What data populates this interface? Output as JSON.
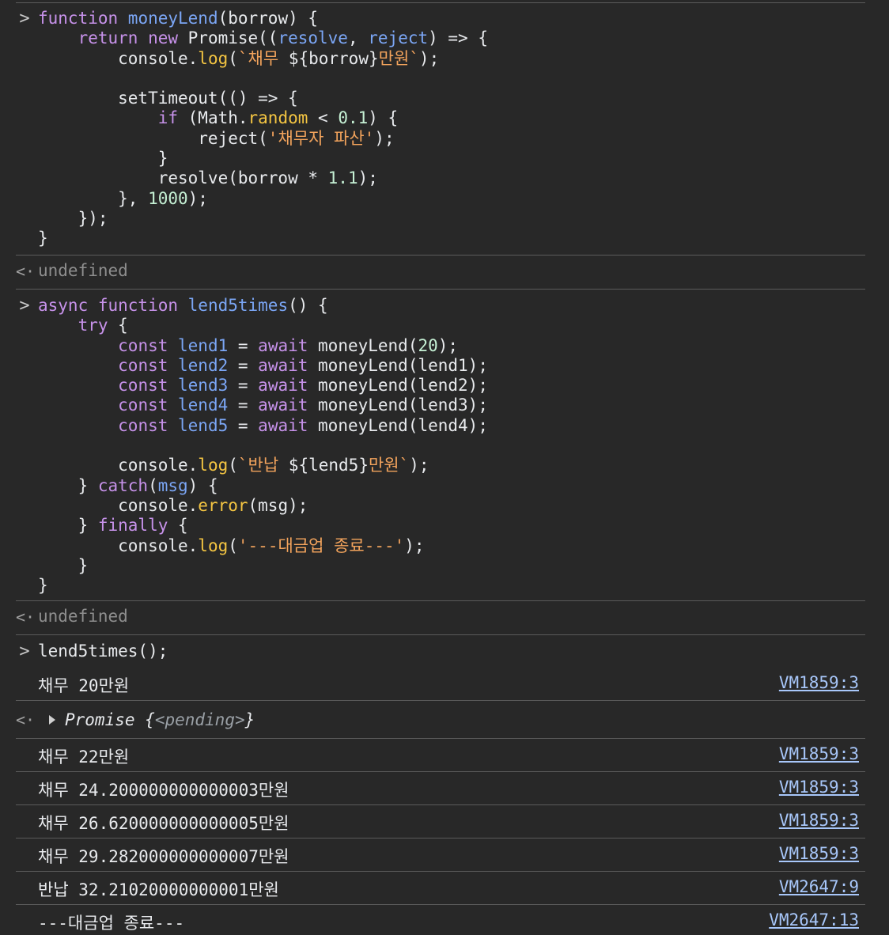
{
  "prompt_symbol": ">",
  "return_symbol": "<·",
  "undefined_text": "undefined",
  "blocks": {
    "b1": {
      "lines": [
        [
          [
            "kw",
            "function "
          ],
          [
            "fn",
            "moneyLend"
          ],
          [
            "p",
            "(borrow) {"
          ]
        ],
        [
          [
            "p",
            "    "
          ],
          [
            "kw",
            "return new "
          ],
          [
            "p",
            "Promise(("
          ],
          [
            "fn",
            "resolve"
          ],
          [
            "p",
            ", "
          ],
          [
            "fn",
            "reject"
          ],
          [
            "p",
            ") => {"
          ]
        ],
        [
          [
            "p",
            "        console."
          ],
          [
            "prop",
            "log"
          ],
          [
            "p",
            "("
          ],
          [
            "str",
            "`채무 "
          ],
          [
            "p",
            "${borrow}"
          ],
          [
            "str",
            "만원`"
          ],
          [
            "p",
            ");"
          ]
        ],
        [],
        [
          [
            "p",
            "        setTimeout(() => {"
          ]
        ],
        [
          [
            "p",
            "            "
          ],
          [
            "kw",
            "if "
          ],
          [
            "p",
            "(Math."
          ],
          [
            "prop",
            "random"
          ],
          [
            "p",
            " < "
          ],
          [
            "num",
            "0.1"
          ],
          [
            "p",
            ") {"
          ]
        ],
        [
          [
            "p",
            "                reject("
          ],
          [
            "str",
            "'채무자 파산'"
          ],
          [
            "p",
            ");"
          ]
        ],
        [
          [
            "p",
            "            }"
          ]
        ],
        [
          [
            "p",
            "            resolve(borrow * "
          ],
          [
            "num",
            "1.1"
          ],
          [
            "p",
            ");"
          ]
        ],
        [
          [
            "p",
            "        }, "
          ],
          [
            "num",
            "1000"
          ],
          [
            "p",
            ");"
          ]
        ],
        [
          [
            "p",
            "    });"
          ]
        ],
        [
          [
            "p",
            "}"
          ]
        ]
      ]
    },
    "b2": {
      "lines": [
        [
          [
            "kw",
            "async function "
          ],
          [
            "fn",
            "lend5times"
          ],
          [
            "p",
            "() {"
          ]
        ],
        [
          [
            "p",
            "    "
          ],
          [
            "kw",
            "try "
          ],
          [
            "p",
            "{"
          ]
        ],
        [
          [
            "p",
            "        "
          ],
          [
            "kw",
            "const "
          ],
          [
            "fn",
            "lend1"
          ],
          [
            "p",
            " = "
          ],
          [
            "kw",
            "await "
          ],
          [
            "p",
            "moneyLend("
          ],
          [
            "num",
            "20"
          ],
          [
            "p",
            ");"
          ]
        ],
        [
          [
            "p",
            "        "
          ],
          [
            "kw",
            "const "
          ],
          [
            "fn",
            "lend2"
          ],
          [
            "p",
            " = "
          ],
          [
            "kw",
            "await "
          ],
          [
            "p",
            "moneyLend(lend1);"
          ]
        ],
        [
          [
            "p",
            "        "
          ],
          [
            "kw",
            "const "
          ],
          [
            "fn",
            "lend3"
          ],
          [
            "p",
            " = "
          ],
          [
            "kw",
            "await "
          ],
          [
            "p",
            "moneyLend(lend2);"
          ]
        ],
        [
          [
            "p",
            "        "
          ],
          [
            "kw",
            "const "
          ],
          [
            "fn",
            "lend4"
          ],
          [
            "p",
            " = "
          ],
          [
            "kw",
            "await "
          ],
          [
            "p",
            "moneyLend(lend3);"
          ]
        ],
        [
          [
            "p",
            "        "
          ],
          [
            "kw",
            "const "
          ],
          [
            "fn",
            "lend5"
          ],
          [
            "p",
            " = "
          ],
          [
            "kw",
            "await "
          ],
          [
            "p",
            "moneyLend(lend4);"
          ]
        ],
        [],
        [
          [
            "p",
            "        console."
          ],
          [
            "prop",
            "log"
          ],
          [
            "p",
            "("
          ],
          [
            "str",
            "`반납 "
          ],
          [
            "p",
            "${lend5}"
          ],
          [
            "str",
            "만원`"
          ],
          [
            "p",
            ");"
          ]
        ],
        [
          [
            "p",
            "    } "
          ],
          [
            "kw",
            "catch"
          ],
          [
            "p",
            "("
          ],
          [
            "fn",
            "msg"
          ],
          [
            "p",
            ") {"
          ]
        ],
        [
          [
            "p",
            "        console."
          ],
          [
            "prop",
            "error"
          ],
          [
            "p",
            "(msg);"
          ]
        ],
        [
          [
            "p",
            "    } "
          ],
          [
            "kw",
            "finally "
          ],
          [
            "p",
            "{"
          ]
        ],
        [
          [
            "p",
            "        console."
          ],
          [
            "prop",
            "log"
          ],
          [
            "p",
            "("
          ],
          [
            "str",
            "'---대금업 종료---'"
          ],
          [
            "p",
            ");"
          ]
        ],
        [
          [
            "p",
            "    }"
          ]
        ],
        [
          [
            "p",
            "}"
          ]
        ]
      ]
    },
    "b3": {
      "lines": [
        [
          [
            "p",
            "lend5times();"
          ]
        ]
      ]
    }
  },
  "promise": {
    "label": "Promise ",
    "open": "{",
    "state": "<pending>",
    "close": "}"
  },
  "logs": [
    {
      "text": "채무 20만원",
      "source": "VM1859:3"
    },
    {
      "text": "채무 22만원",
      "source": "VM1859:3"
    },
    {
      "text": "채무 24.200000000000003만원",
      "source": "VM1859:3"
    },
    {
      "text": "채무 26.620000000000005만원",
      "source": "VM1859:3"
    },
    {
      "text": "채무 29.282000000000007만원",
      "source": "VM1859:3"
    },
    {
      "text": "반납 32.21020000000001만원",
      "source": "VM2647:9"
    },
    {
      "text": "---대금업 종료---",
      "source": "VM2647:13"
    }
  ],
  "colors": {
    "background": "#282828",
    "keyword": "#c792ea",
    "function": "#7ba6f5",
    "string": "#f2a35c",
    "number": "#c5f0d4",
    "property": "#f4c542",
    "link": "#a8c7fa"
  }
}
